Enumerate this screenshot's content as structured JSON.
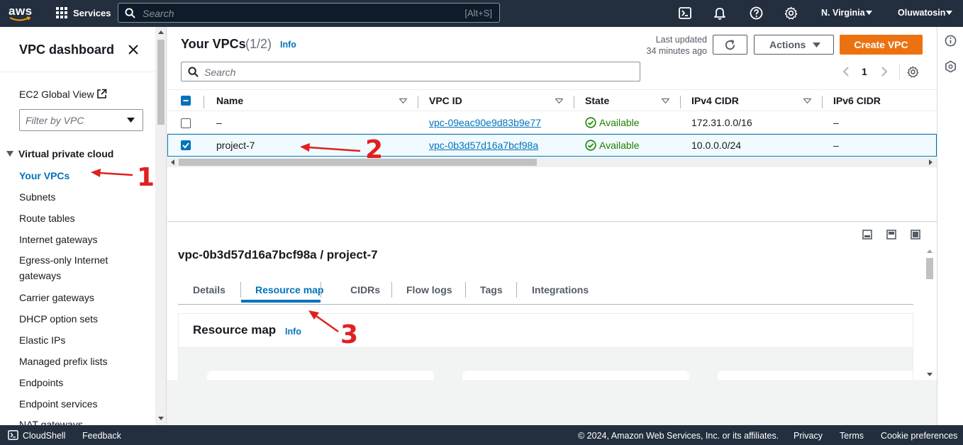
{
  "topnav": {
    "logo": "aws",
    "services_label": "Services",
    "search_placeholder": "Search",
    "search_shortcut": "[Alt+S]",
    "region": "N. Virginia",
    "user": "Oluwatosin"
  },
  "sidebar": {
    "title": "VPC dashboard",
    "global_view": "EC2 Global View",
    "filter_placeholder": "Filter by VPC",
    "section": "Virtual private cloud",
    "items": [
      {
        "label": "Your VPCs"
      },
      {
        "label": "Subnets"
      },
      {
        "label": "Route tables"
      },
      {
        "label": "Internet gateways"
      },
      {
        "label": "Egress-only Internet gateways"
      },
      {
        "label": "Carrier gateways"
      },
      {
        "label": "DHCP option sets"
      },
      {
        "label": "Elastic IPs"
      },
      {
        "label": "Managed prefix lists"
      },
      {
        "label": "Endpoints"
      },
      {
        "label": "Endpoint services"
      },
      {
        "label": "NAT gateways"
      }
    ]
  },
  "vpcs": {
    "title": "Your VPCs",
    "count": "(1/2)",
    "info": "Info",
    "last_updated_line1": "Last updated",
    "last_updated_line2": "34 minutes ago",
    "actions_label": "Actions",
    "create_label": "Create VPC",
    "search_placeholder": "Search",
    "page": "1",
    "columns": [
      "Name",
      "VPC ID",
      "State",
      "IPv4 CIDR",
      "IPv6 CIDR"
    ],
    "rows": [
      {
        "name": "–",
        "vpc_id": "vpc-09eac90e9d83b9e77",
        "state": "Available",
        "ipv4": "172.31.0.0/16",
        "ipv6": "–",
        "selected": false
      },
      {
        "name": "project-7",
        "vpc_id": "vpc-0b3d57d16a7bcf98a",
        "state": "Available",
        "ipv4": "10.0.0.0/24",
        "ipv6": "–",
        "selected": true
      }
    ]
  },
  "detail": {
    "title": "vpc-0b3d57d16a7bcf98a / project-7",
    "tabs": [
      "Details",
      "Resource map",
      "CIDRs",
      "Flow logs",
      "Tags",
      "Integrations"
    ],
    "active_tab": "Resource map",
    "section_title": "Resource map",
    "section_info": "Info"
  },
  "annotations": [
    "1",
    "2",
    "3"
  ],
  "footer": {
    "cloudshell": "CloudShell",
    "feedback": "Feedback",
    "copyright": "© 2024, Amazon Web Services, Inc. or its affiliates.",
    "privacy": "Privacy",
    "terms": "Terms",
    "cookies": "Cookie preferences"
  },
  "colors": {
    "nav_bg": "#232f3e",
    "accent": "#0073bb",
    "primary_button": "#ec7211",
    "available_green": "#1d8102",
    "annotation_red": "#e02020"
  }
}
